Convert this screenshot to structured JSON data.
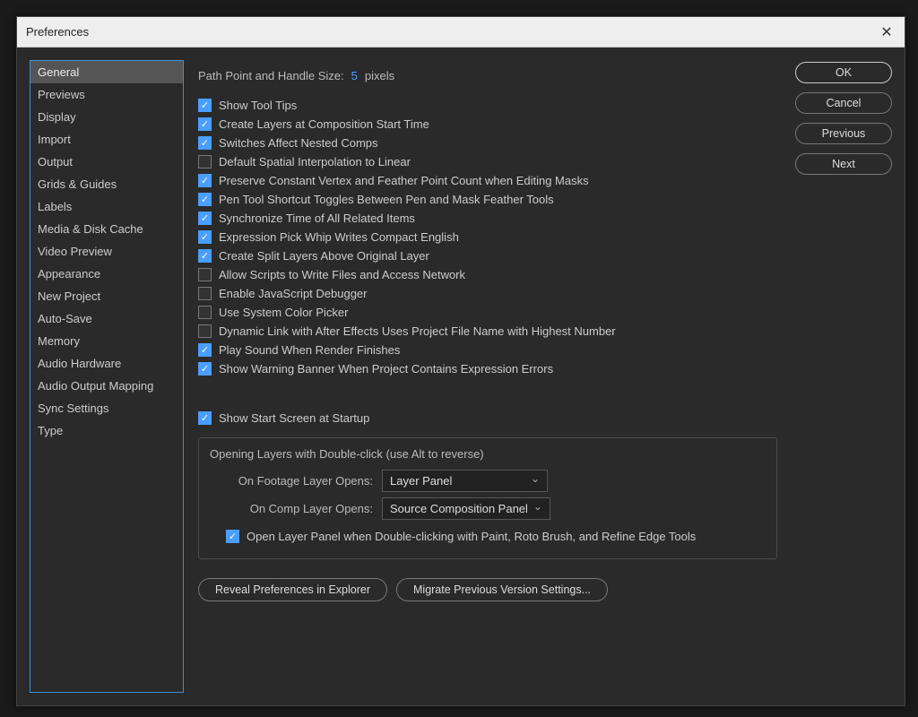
{
  "window": {
    "title": "Preferences"
  },
  "sidebar": {
    "items": [
      {
        "label": "General",
        "active": true
      },
      {
        "label": "Previews",
        "active": false
      },
      {
        "label": "Display",
        "active": false
      },
      {
        "label": "Import",
        "active": false
      },
      {
        "label": "Output",
        "active": false
      },
      {
        "label": "Grids & Guides",
        "active": false
      },
      {
        "label": "Labels",
        "active": false
      },
      {
        "label": "Media & Disk Cache",
        "active": false
      },
      {
        "label": "Video Preview",
        "active": false
      },
      {
        "label": "Appearance",
        "active": false
      },
      {
        "label": "New Project",
        "active": false
      },
      {
        "label": "Auto-Save",
        "active": false
      },
      {
        "label": "Memory",
        "active": false
      },
      {
        "label": "Audio Hardware",
        "active": false
      },
      {
        "label": "Audio Output Mapping",
        "active": false
      },
      {
        "label": "Sync Settings",
        "active": false
      },
      {
        "label": "Type",
        "active": false
      }
    ]
  },
  "path": {
    "label": "Path Point and Handle Size:",
    "value": "5",
    "unit": "pixels"
  },
  "checks": [
    {
      "label": "Show Tool Tips",
      "checked": true
    },
    {
      "label": "Create Layers at Composition Start Time",
      "checked": true
    },
    {
      "label": "Switches Affect Nested Comps",
      "checked": true
    },
    {
      "label": "Default Spatial Interpolation to Linear",
      "checked": false
    },
    {
      "label": "Preserve Constant Vertex and Feather Point Count when Editing Masks",
      "checked": true
    },
    {
      "label": "Pen Tool Shortcut Toggles Between Pen and Mask Feather Tools",
      "checked": true
    },
    {
      "label": "Synchronize Time of All Related Items",
      "checked": true
    },
    {
      "label": "Expression Pick Whip Writes Compact English",
      "checked": true
    },
    {
      "label": "Create Split Layers Above Original Layer",
      "checked": true
    },
    {
      "label": "Allow Scripts to Write Files and Access Network",
      "checked": false
    },
    {
      "label": "Enable JavaScript Debugger",
      "checked": false
    },
    {
      "label": "Use System Color Picker",
      "checked": false
    },
    {
      "label": "Dynamic Link with After Effects Uses Project File Name with Highest Number",
      "checked": false
    },
    {
      "label": "Play Sound When Render Finishes",
      "checked": true
    },
    {
      "label": "Show Warning Banner When Project Contains Expression Errors",
      "checked": true
    }
  ],
  "startup": {
    "show_start_screen": {
      "label": "Show Start Screen at Startup",
      "checked": true
    }
  },
  "dblclick": {
    "group_title": "Opening Layers with Double-click (use Alt to reverse)",
    "footage": {
      "label": "On Footage Layer Opens:",
      "value": "Layer Panel"
    },
    "comp": {
      "label": "On Comp Layer Opens:",
      "value": "Source Composition Panel"
    },
    "open_panel": {
      "label": "Open Layer Panel when Double-clicking with Paint, Roto Brush, and Refine Edge Tools",
      "checked": true
    }
  },
  "bottom": {
    "reveal": "Reveal Preferences in Explorer",
    "migrate": "Migrate Previous Version Settings..."
  },
  "buttons": {
    "ok": "OK",
    "cancel": "Cancel",
    "previous": "Previous",
    "next": "Next"
  }
}
